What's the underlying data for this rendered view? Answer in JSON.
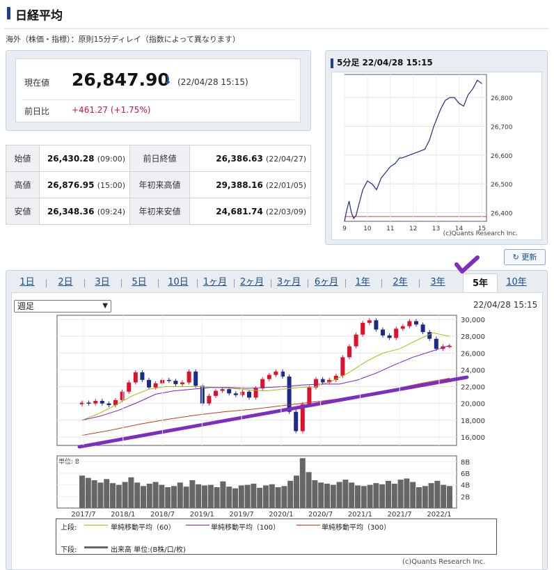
{
  "header": {
    "title": "日経平均"
  },
  "note": "海外（株価・指標）：原則15分ディレイ（指数によって異なります）",
  "price": {
    "label": "現在値",
    "value": "26,847.90",
    "arrow": "↓",
    "timestamp": "(22/04/28 15:15)",
    "change_label": "前日比",
    "change": "+461.27 (+1.75%)"
  },
  "stats": [
    {
      "l1": "始値",
      "v1": "26,430.28",
      "t1": "(09:00)",
      "l2": "前日終値",
      "v2": "26,386.63",
      "t2": "(22/04/27)"
    },
    {
      "l1": "高値",
      "v1": "26,876.95",
      "t1": "(15:00)",
      "l2": "年初来高値",
      "v2": "29,388.16",
      "t2": "(22/01/05)"
    },
    {
      "l1": "安値",
      "v1": "26,348.36",
      "t1": "(09:24)",
      "l2": "年初来安値",
      "v2": "24,681.74",
      "t2": "(22/03/09)"
    }
  ],
  "mini": {
    "title": "5分足 22/04/28 15:15",
    "copyright": "(c)Quants Research Inc.",
    "yticks": [
      "26,800",
      "26,700",
      "26,600",
      "26,500",
      "26,400"
    ],
    "xticks": [
      "9",
      "10",
      "11",
      "12",
      "13",
      "14",
      "15"
    ]
  },
  "refresh_label": "更新",
  "tabs": [
    "1日",
    "2日",
    "3日",
    "5日",
    "10日",
    "1ヶ月",
    "2ヶ月",
    "3ヶ月",
    "6ヶ月",
    "1年",
    "2年",
    "3年",
    "5年",
    "10年"
  ],
  "active_tab": "5年",
  "select_value": "週足",
  "main_stamp": "22/04/28 15:15",
  "main_yticks": [
    "30,000",
    "28,000",
    "26,000",
    "24,000",
    "22,000",
    "20,000",
    "18,000",
    "16,000"
  ],
  "vol_label": "単位: B",
  "vol_yticks": [
    "8B",
    "6B",
    "4B",
    "2B"
  ],
  "main_xticks": [
    "2017/7",
    "2018/1",
    "2018/7",
    "2019/1",
    "2019/7",
    "2020/1",
    "2020/7",
    "2021/1",
    "2021/7",
    "2022/1"
  ],
  "legend": {
    "upper": "上段:",
    "sma60": "単純移動平均（60）",
    "sma100": "単純移動平均（100）",
    "sma300": "単純移動平均（300）",
    "lower": "下段:",
    "volume": "出来高 単位:(B株/口/枚)"
  },
  "main_copyright": "(c)Quants Research Inc.",
  "colors": {
    "up": "#e0102c",
    "down": "#1d2a8a",
    "sma60": "#9ac400",
    "sma100": "#7a1ed0",
    "sma300": "#c83a1a",
    "trend": "#7d2ec0",
    "accent": "#1a4a8a"
  },
  "chart_data": [
    {
      "type": "line",
      "title": "5分足 22/04/28 15:15",
      "ylim": [
        26370,
        26880
      ],
      "xlim": [
        9,
        15.2
      ],
      "x": [
        9.0,
        9.1,
        9.2,
        9.3,
        9.4,
        9.5,
        9.6,
        9.7,
        9.8,
        10.0,
        10.2,
        10.4,
        10.6,
        10.8,
        11.0,
        11.2,
        11.4,
        11.5,
        12.5,
        12.7,
        12.9,
        13.0,
        13.2,
        13.4,
        13.6,
        13.8,
        14.0,
        14.2,
        14.4,
        14.6,
        14.8,
        15.0
      ],
      "values": [
        26370,
        26410,
        26440,
        26400,
        26380,
        26390,
        26420,
        26450,
        26480,
        26510,
        26500,
        26480,
        26520,
        26540,
        26560,
        26570,
        26590,
        26590,
        26620,
        26650,
        26700,
        26720,
        26760,
        26790,
        26800,
        26800,
        26780,
        26770,
        26810,
        26830,
        26860,
        26848
      ]
    },
    {
      "type": "line",
      "title": "",
      "ylim": [
        15000,
        30500
      ],
      "x_tick_labels": [
        "2017/7",
        "2018/1",
        "2018/7",
        "2019/1",
        "2019/7",
        "2020/1",
        "2020/7",
        "2021/1",
        "2021/7",
        "2022/1"
      ],
      "series": [
        {
          "name": "週足",
          "values": [
            20100,
            20000,
            20300,
            20000,
            19800,
            20400,
            21400,
            22500,
            23700,
            22800,
            21900,
            22400,
            22800,
            22700,
            22300,
            22500,
            23800,
            22100,
            20000,
            20900,
            21500,
            21700,
            21200,
            21000,
            21400,
            20700,
            21800,
            22900,
            23400,
            23800,
            23200,
            19000,
            16700,
            19900,
            21900,
            22900,
            22500,
            22800,
            23300,
            25500,
            26800,
            28200,
            29600,
            29900,
            28800,
            28100,
            27800,
            28900,
            29200,
            29800,
            29400,
            28500,
            27700,
            26500,
            26800,
            26850
          ]
        },
        {
          "name": "単純移動平均（60）",
          "values": [
            18000,
            18800,
            19800,
            20900,
            21700,
            22000,
            22000,
            22000,
            21900,
            21800,
            21600,
            21500,
            21700,
            21900,
            22000,
            22700,
            23700,
            25000,
            26000,
            26500,
            27500,
            28400,
            28000
          ]
        },
        {
          "name": "単純移動平均（100）",
          "values": [
            18000,
            18500,
            19200,
            20100,
            21100,
            21500,
            21700,
            21900,
            21900,
            21800,
            21900,
            22000,
            22200,
            22300,
            22300,
            22800,
            23600,
            24600,
            25500,
            26200,
            26900
          ]
        },
        {
          "name": "単純移動平均（300）",
          "values": [
            16200,
            16800,
            17500,
            18100,
            18600,
            19000,
            19300,
            19700,
            20100,
            20500,
            21100,
            21700,
            22400,
            23000
          ]
        }
      ]
    },
    {
      "type": "bar",
      "title": "",
      "ylabel": "単位: B",
      "ylim": [
        0,
        9
      ],
      "values": [
        5.6,
        5.2,
        4.8,
        4.4,
        5.0,
        4.3,
        4.0,
        4.5,
        5.3,
        4.4,
        3.8,
        4.2,
        4.5,
        4.0,
        3.6,
        3.8,
        4.4,
        3.7,
        4.8,
        4.1,
        3.9,
        4.0,
        3.6,
        4.6,
        3.7,
        3.4,
        3.9,
        4.0,
        4.2,
        3.5,
        3.9,
        4.1,
        3.6,
        3.8,
        4.7,
        5.6,
        8.6,
        6.2,
        4.8,
        4.4,
        4.2,
        4.0,
        4.5,
        4.9,
        4.4,
        3.9,
        3.8,
        4.0,
        4.3,
        4.1,
        4.7,
        4.2,
        4.9,
        5.1,
        4.5,
        3.6,
        3.8,
        4.3,
        4.7,
        4.0,
        3.8
      ]
    }
  ]
}
